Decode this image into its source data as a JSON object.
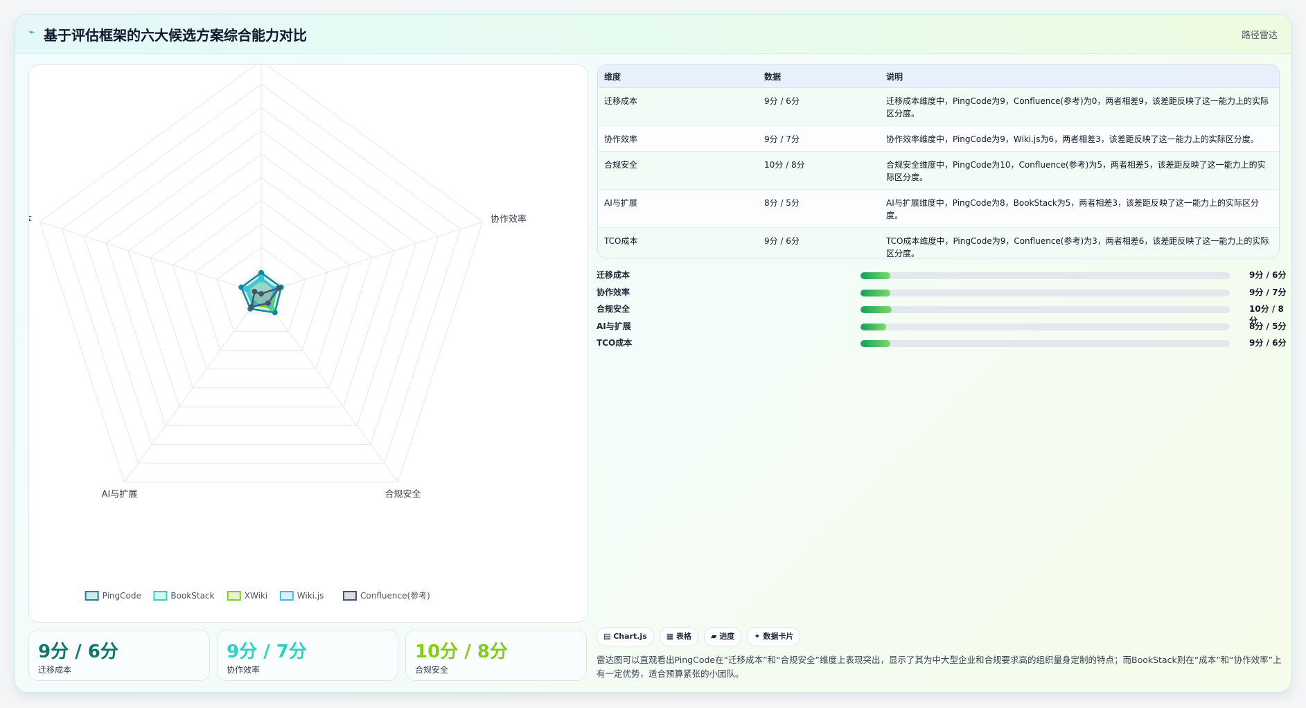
{
  "header": {
    "icon": "chart-line-icon",
    "title": "基于评估框架的六大候选方案综合能力对比",
    "tag": "路径雷达"
  },
  "chart_data": {
    "type": "radar",
    "axes": [
      "迁移成本",
      "协作效率",
      "合规安全",
      "AI与扩展",
      "TCO成本"
    ],
    "rmax": 100,
    "ring_count": 10,
    "grid": true,
    "legend_position": "bottom",
    "series": [
      {
        "name": "PingCode",
        "values": [
          9,
          9,
          10,
          8,
          9
        ],
        "color": "#0f8b8d"
      },
      {
        "name": "BookStack",
        "values": [
          6,
          7,
          8,
          5,
          6
        ],
        "color": "#2dd4bf"
      },
      {
        "name": "XWiki",
        "values": [
          7,
          6,
          7,
          6,
          7
        ],
        "color": "#84cc16"
      },
      {
        "name": "Wiki.js",
        "values": [
          7,
          6,
          6,
          6,
          7
        ],
        "color": "#38bdf8"
      },
      {
        "name": "Confluence(参考)",
        "values": [
          0,
          8,
          5,
          7,
          3
        ],
        "color": "#475569"
      }
    ]
  },
  "kpis": [
    {
      "value": "9分 / 6分",
      "label": "迁移成本",
      "color": "#0f766e"
    },
    {
      "value": "9分 / 7分",
      "label": "协作效率",
      "color": "#2dd4bf"
    },
    {
      "value": "10分 / 8分",
      "label": "合规安全",
      "color": "#84cc16"
    }
  ],
  "table": {
    "headers": [
      "维度",
      "数据",
      "说明"
    ],
    "rows": [
      [
        "迁移成本",
        "9分 / 6分",
        "迁移成本维度中，PingCode为9，Confluence(参考)为0，两者相差9，该差距反映了这一能力上的实际区分度。"
      ],
      [
        "协作效率",
        "9分 / 7分",
        "协作效率维度中，PingCode为9，Wiki.js为6，两者相差3，该差距反映了这一能力上的实际区分度。"
      ],
      [
        "合规安全",
        "10分 / 8分",
        "合规安全维度中，PingCode为10，Confluence(参考)为5，两者相差5，该差距反映了这一能力上的实际区分度。"
      ],
      [
        "AI与扩展",
        "8分 / 5分",
        "AI与扩展维度中，PingCode为8，BookStack为5，两者相差3，该差距反映了这一能力上的实际区分度。"
      ],
      [
        "TCO成本",
        "9分 / 6分",
        "TCO成本维度中，PingCode为9，Confluence(参考)为3，两者相差6，该差距反映了这一能力上的实际区分度。"
      ]
    ]
  },
  "progress": [
    {
      "label": "迁移成本",
      "value_text": "9分 / 6分",
      "fraction": 0.08
    },
    {
      "label": "协作效率",
      "value_text": "9分 / 7分",
      "fraction": 0.08
    },
    {
      "label": "合规安全",
      "value_text": "10分 / 8分",
      "fraction": 0.085
    },
    {
      "label": "AI与扩展",
      "value_text": "8分 / 5分",
      "fraction": 0.07
    },
    {
      "label": "TCO成本",
      "value_text": "9分 / 6分",
      "fraction": 0.08
    }
  ],
  "chips": [
    {
      "icon": "chart-icon",
      "label": "Chart.js"
    },
    {
      "icon": "table-icon",
      "label": "表格"
    },
    {
      "icon": "progress-icon",
      "label": "进度"
    },
    {
      "icon": "card-icon",
      "label": "数据卡片"
    }
  ],
  "note": "雷达图可以直观看出PingCode在“迁移成本”和“合规安全”维度上表现突出，显示了其为中大型企业和合规要求高的组织量身定制的特点；而BookStack则在“成本”和“协作效率”上有一定优势，适合预算紧张的小团队。"
}
